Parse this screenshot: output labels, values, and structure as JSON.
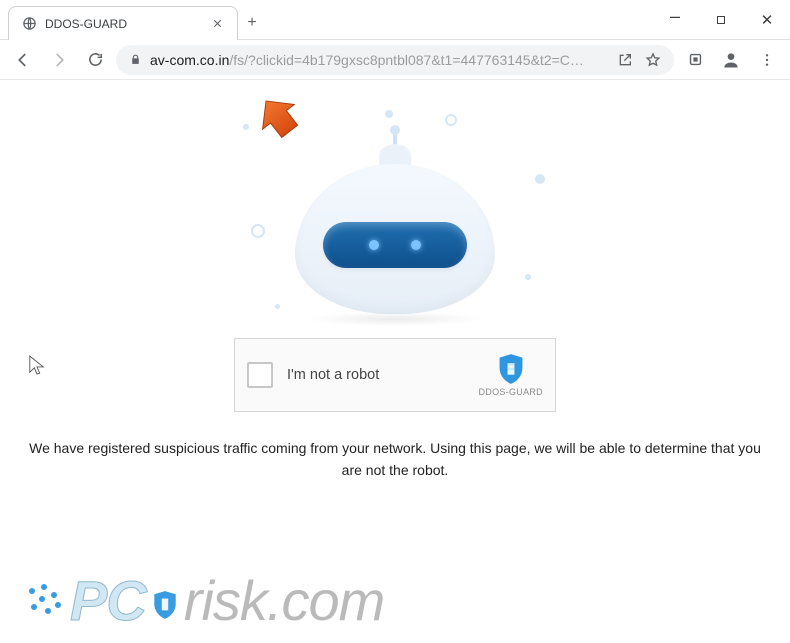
{
  "window": {
    "tab_title": "DDOS-GUARD",
    "new_tab_glyph": "+",
    "controls": {
      "min": "–",
      "max": "▢",
      "close": "✕"
    }
  },
  "toolbar": {
    "back": "←",
    "forward": "→",
    "reload": "⟳",
    "url_host": "av-com.co.in",
    "url_rest": "/fs/?clickid=4b179gxsc8pntbl087&t1=447763145&t2=C…",
    "share_glyph": "↗",
    "star_glyph": "☆",
    "ext_glyph": "▣",
    "profile_glyph": "◉",
    "menu_glyph": "⋮"
  },
  "page": {
    "captcha_label": "I'm not a robot",
    "brand_label": "DDOS-GUARD",
    "message": "We have registered suspicious traffic coming from your network. Using this page, we will be able to determine that you are not the robot."
  },
  "watermark": {
    "pc": "PC",
    "risk": "risk",
    "com": ".com"
  },
  "colors": {
    "shield": "#2f97e0",
    "arrow": "#e35a1e"
  }
}
